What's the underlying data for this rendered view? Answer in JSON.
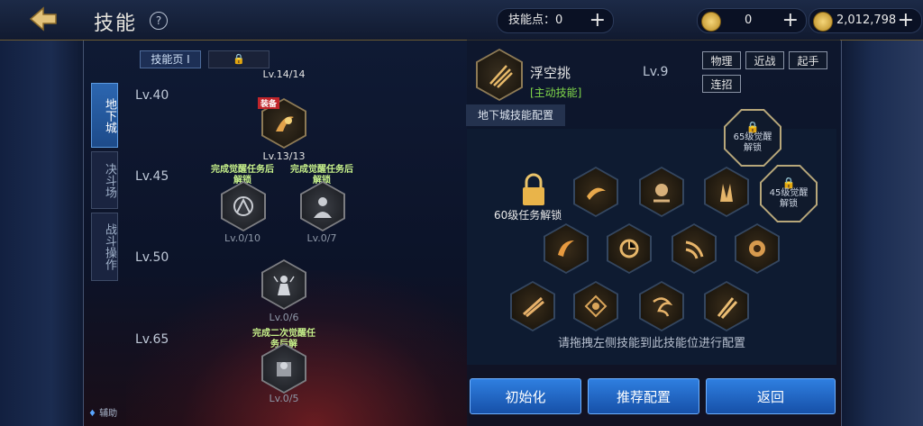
{
  "header": {
    "title": "技能",
    "help": "?"
  },
  "currency": {
    "skill_points_label": "技能点",
    "skill_points_value": "0",
    "coin1_value": "0",
    "coin2_value": "2,012,798"
  },
  "side_tabs": [
    {
      "label": "地下城",
      "active": true
    },
    {
      "label": "决斗场",
      "active": false
    },
    {
      "label": "战斗操作",
      "active": false
    }
  ],
  "assist_label": "辅助",
  "skill_pages": {
    "page1": "技能页 I",
    "page2_locked": true
  },
  "tree": {
    "top_level_caption": "Lv.14/14",
    "levels": [
      "Lv.40",
      "Lv.45",
      "Lv.50",
      "Lv.65"
    ],
    "equip_badge": "装备",
    "nodes": [
      {
        "caption": "Lv.13/13"
      },
      {
        "note": "完成觉醒任务后解锁",
        "caption": "Lv.0/10"
      },
      {
        "note": "完成觉醒任务后解锁",
        "caption": "Lv.0/7"
      },
      {
        "caption": "Lv.0/6"
      },
      {
        "note": "完成二次觉醒任务后解",
        "caption": "Lv.0/5"
      }
    ]
  },
  "skill_detail": {
    "name": "浮空挑",
    "type": "[主动技能]",
    "level": "Lv.9",
    "tags": [
      "物理",
      "近战",
      "起手",
      "连招"
    ]
  },
  "config": {
    "header": "地下城技能配置",
    "slot60_label": "60级任务解锁",
    "slot65_label1": "65级觉醒",
    "slot65_label2": "解锁",
    "slot45_label1": "45级觉醒",
    "slot45_label2": "解锁",
    "hint": "请拖拽左侧技能到此技能位进行配置"
  },
  "buttons": {
    "reset": "初始化",
    "recommend": "推荐配置",
    "back": "返回"
  }
}
